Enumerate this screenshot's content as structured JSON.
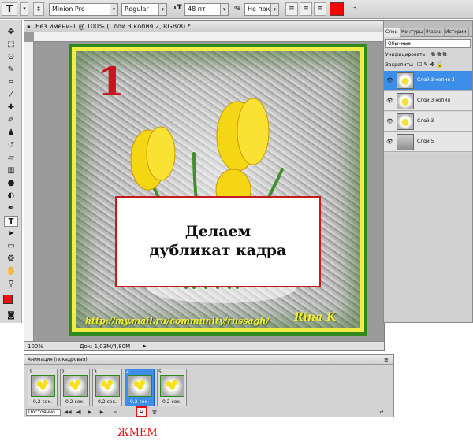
{
  "options_bar": {
    "tool_glyph": "T",
    "font_family": "Minion Pro",
    "font_style": "Regular",
    "font_size": "48 пт",
    "antialias": "Не показывать",
    "colors": {
      "text_color": "#ff0000"
    }
  },
  "document": {
    "title": "Без имени-1 @ 100% (Слой 3 копия 2, RGB/8) *",
    "zoom": "100%",
    "doc_info": "Док: 1,03M/4,80M",
    "frame_number": "1",
    "caption": "Делаем\nдубликат кадра",
    "url_text": "http://my.mail.ru/community/russagh/",
    "signature": "Rina K"
  },
  "layers_panel": {
    "tabs": [
      "Слои",
      "Контуры",
      "Маски",
      "Истории"
    ],
    "blend_mode": "Обычные",
    "unify_label": "Унифицировать:",
    "lock_label": "Закрепить:",
    "layers": [
      {
        "name": "Слой 3 копия 2",
        "selected": true
      },
      {
        "name": "Слой 3 копия",
        "selected": false
      },
      {
        "name": "Слой 3",
        "selected": false
      },
      {
        "name": "Слой 5",
        "selected": false
      }
    ]
  },
  "animation_panel": {
    "title": "Анимация (покадровая)",
    "frames": [
      {
        "num": "1",
        "delay": "0,2 сек.",
        "selected": false
      },
      {
        "num": "2",
        "delay": "0,2 сек.",
        "selected": false
      },
      {
        "num": "3",
        "delay": "0,2 сек.",
        "selected": false
      },
      {
        "num": "4",
        "delay": "0,2 сек.",
        "selected": true
      },
      {
        "num": "5",
        "delay": "0,2 сек.",
        "selected": false
      }
    ],
    "loop": "Постоянно"
  },
  "annotation": "ЖМЕМ"
}
